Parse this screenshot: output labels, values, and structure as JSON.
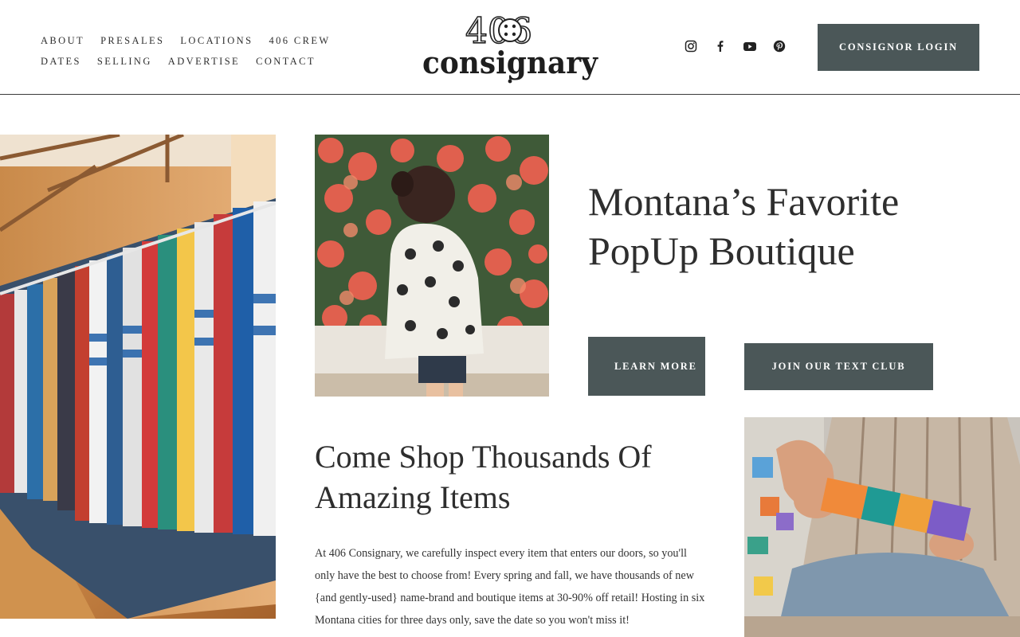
{
  "nav": {
    "row1": [
      "ABOUT",
      "PRESALES",
      "LOCATIONS",
      "406 CREW"
    ],
    "row2": [
      "DATES",
      "SELLING",
      "ADVERTISE",
      "CONTACT"
    ]
  },
  "logo": {
    "number": "406",
    "word": "consignary"
  },
  "social": [
    "instagram-icon",
    "facebook-icon",
    "youtube-icon",
    "pinterest-icon"
  ],
  "header": {
    "login_label": "CONSIGNOR LOGIN"
  },
  "hero": {
    "title": "Montana’s Favorite PopUp Boutique",
    "learn_more_label": "LEARN MORE",
    "text_club_label": "JOIN OUR TEXT CLUB"
  },
  "shop": {
    "title": "Come Shop Thousands Of Amazing Items",
    "body": "At 406 Consignary, we carefully inspect every item that enters our doors, so you'll only have the best to choose from! Every spring and fall, we have thousands of new {and gently-used} name-brand and boutique items at 30-90% off retail! Hosting in six Montana cities for three days only, save the date so you won't miss it!"
  },
  "colors": {
    "button": "#4b5758",
    "text": "#2e2e2e"
  }
}
